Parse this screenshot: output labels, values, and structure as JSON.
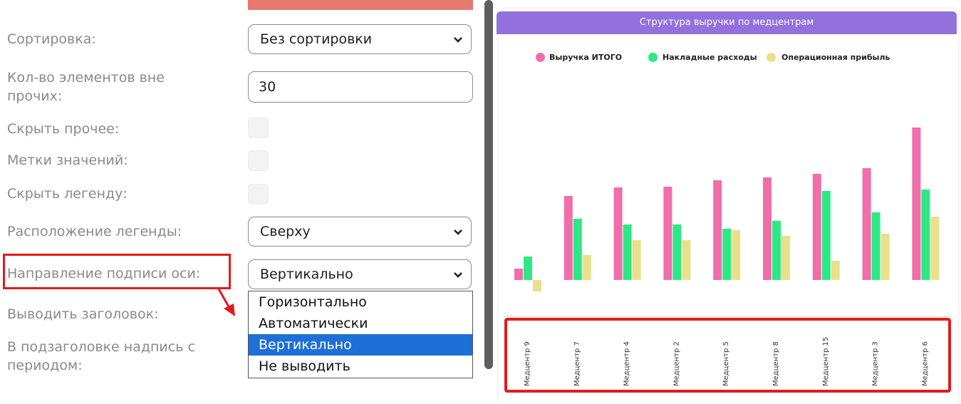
{
  "settings": {
    "sort_label": "Сортировка:",
    "sort_value": "Без сортировки",
    "elements_label_line1": "Кол-во элементов вне",
    "elements_label_line2": "прочих:",
    "elements_value": "30",
    "hide_other_label": "Скрыть прочее:",
    "value_labels_label": "Метки значений:",
    "hide_legend_label": "Скрыть легенду:",
    "legend_position_label": "Расположение легенды:",
    "legend_position_value": "Сверху",
    "axis_label_direction_label": "Направление подписи оси:",
    "axis_label_direction_value": "Вертикально",
    "show_title_label": "Выводить заголовок:",
    "subtitle_period_line1": "В подзаголовке надпись с",
    "subtitle_period_line2": "периодом:"
  },
  "dropdown": {
    "options": [
      "Горизонтально",
      "Автоматически",
      "Вертикально",
      "Не выводить"
    ],
    "selected_index": 2
  },
  "colors": {
    "selected_option": "#1e6fd6",
    "highlight_box": "#e11b1b",
    "title_bar": "#9370db"
  },
  "chart_data": {
    "type": "bar",
    "title": "Структура выручки по медцентрам",
    "legend_position": "top",
    "label_orientation": "vertical",
    "categories": [
      "Медцентр 9",
      "Медцентр 7",
      "Медцентр 4",
      "Медцентр 2",
      "Медцентр 5",
      "Медцентр 8",
      "Медцентр 15",
      "Медцентр 3",
      "Медцентр 6"
    ],
    "series": [
      {
        "name": "Выручка ИТОГО",
        "color": "#f06eaa",
        "values": [
          16,
          118,
          130,
          131,
          140,
          144,
          149,
          157,
          214
        ]
      },
      {
        "name": "Накладные расходы",
        "color": "#2ee886",
        "values": [
          33,
          86,
          78,
          78,
          72,
          83,
          125,
          95,
          127
        ]
      },
      {
        "name": "Операционная прибыль",
        "color": "#ebe08a",
        "values": [
          -16,
          35,
          56,
          56,
          70,
          62,
          27,
          65,
          89
        ]
      }
    ],
    "ylim": [
      -30,
      230
    ],
    "grid": false
  }
}
